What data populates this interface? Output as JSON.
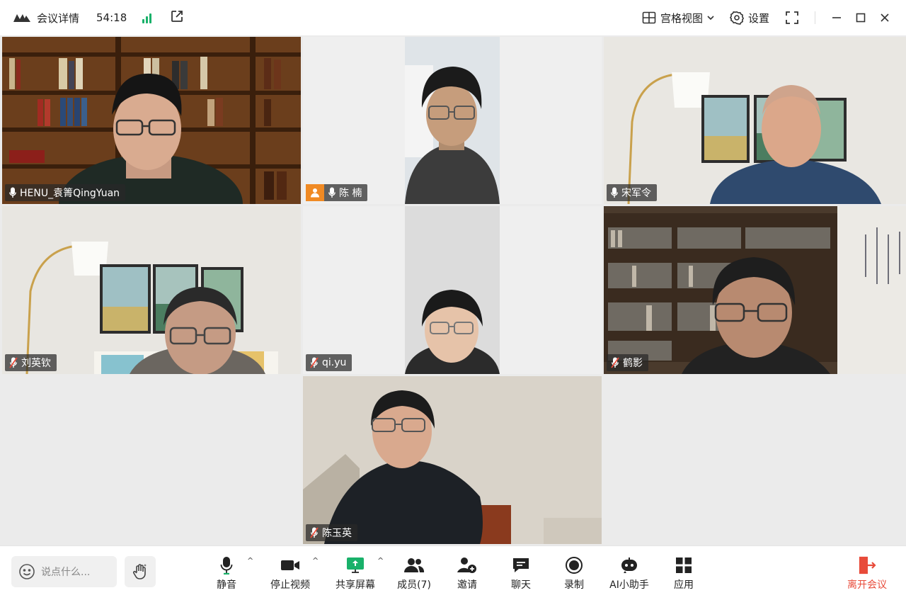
{
  "titlebar": {
    "meeting_title": "会议详情",
    "elapsed": "54:18",
    "view_mode": "宫格视图",
    "settings": "设置"
  },
  "participants": [
    {
      "name": "HENU_袁箐QingYuan",
      "mic": "on",
      "host": false,
      "active": false
    },
    {
      "name": "陈 楠",
      "mic": "on",
      "host": true,
      "active": true
    },
    {
      "name": "宋军令",
      "mic": "on",
      "host": false,
      "active": false
    },
    {
      "name": "刘英钦",
      "mic": "muted",
      "host": false,
      "active": false
    },
    {
      "name": "qi.yu",
      "mic": "muted",
      "host": false,
      "active": false
    },
    {
      "name": "鹤影",
      "mic": "muted",
      "host": false,
      "active": false
    },
    {
      "name": "陈玉英",
      "mic": "muted",
      "host": false,
      "active": false
    }
  ],
  "toolbar": {
    "chat_placeholder": "说点什么...",
    "mute": "静音",
    "stop_video": "停止视频",
    "share_screen": "共享屏幕",
    "members": "成员(7)",
    "invite": "邀请",
    "chat": "聊天",
    "record": "录制",
    "ai_assistant": "AI小助手",
    "apps": "应用",
    "leave": "离开会议"
  },
  "colors": {
    "active_border": "#1fc47d",
    "host_badge": "#f08a24",
    "leave": "#e84b3a",
    "signal": "#19b16a"
  }
}
